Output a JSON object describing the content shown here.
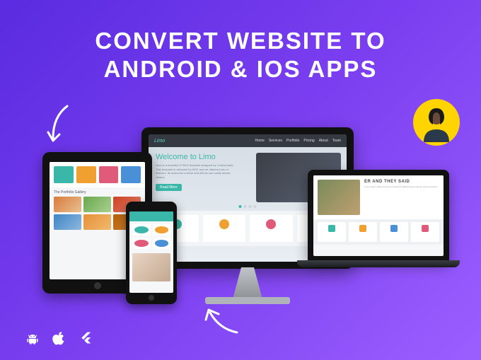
{
  "headline": {
    "line1": "CONVERT WEBSITE TO",
    "line2": "ANDROID & IOS APPS"
  },
  "site": {
    "brand": "Limo",
    "nav": [
      "Home",
      "Services",
      "Portfolio",
      "Pricing",
      "About",
      "Team"
    ],
    "hero_title": "Welcome to Limo",
    "hero_text": "Limo is a beautiful HTML5 template designed by CodesCastle. This template is validated by W3C and we attached lots of features. Its awesome outlook and effects can easily amaze visitors.",
    "hero_button": "Read More"
  },
  "tablet": {
    "section_title": "The Portfolio Gallery"
  },
  "laptop": {
    "section_title": "ER AND THEY SAID"
  },
  "tech": {
    "android": "android-icon",
    "apple": "apple-icon",
    "flutter": "flutter-icon"
  }
}
